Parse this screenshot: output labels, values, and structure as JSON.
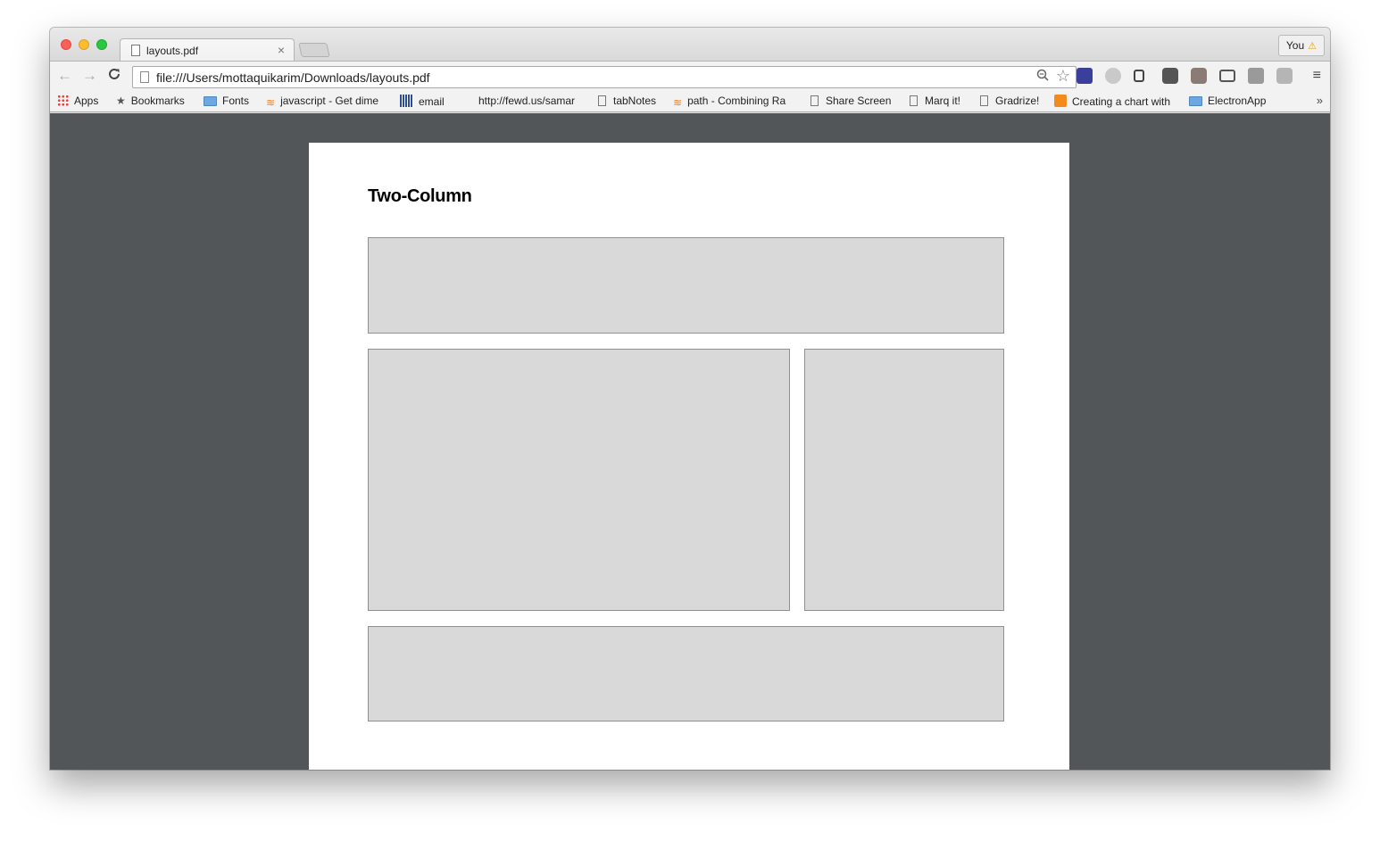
{
  "tab": {
    "title": "layouts.pdf",
    "close": "×"
  },
  "profile": {
    "label": "You",
    "warning": "⚠"
  },
  "toolbar": {
    "back": "←",
    "forward": "→",
    "reload": "C",
    "url": "file:///Users/mottaquikarim/Downloads/layouts.pdf"
  },
  "bookmarks": [
    {
      "label": "Apps",
      "icon": "apps-icon"
    },
    {
      "label": "Bookmarks",
      "icon": "star-icon"
    },
    {
      "label": "Fonts",
      "icon": "folder-icon"
    },
    {
      "label": "javascript - Get dime",
      "icon": "stackoverflow-icon"
    },
    {
      "label": "email",
      "icon": "grid-icon"
    },
    {
      "label": "http://fewd.us/samar",
      "icon": "none"
    },
    {
      "label": "tabNotes",
      "icon": "page-icon"
    },
    {
      "label": "path - Combining Ra",
      "icon": "stackoverflow-icon"
    },
    {
      "label": "Share Screen",
      "icon": "page-icon"
    },
    {
      "label": "Marq it!",
      "icon": "page-icon"
    },
    {
      "label": "Gradrize!",
      "icon": "page-icon"
    },
    {
      "label": "Creating a chart with",
      "icon": "rss-icon"
    },
    {
      "label": "ElectronApp",
      "icon": "folder-icon"
    }
  ],
  "bookmarks_more": "»",
  "pdf": {
    "heading": "Two-Column"
  },
  "colors": {
    "content_bg": "#525659",
    "box_fill": "#d9d9d9",
    "box_border": "#8f8f8f"
  }
}
